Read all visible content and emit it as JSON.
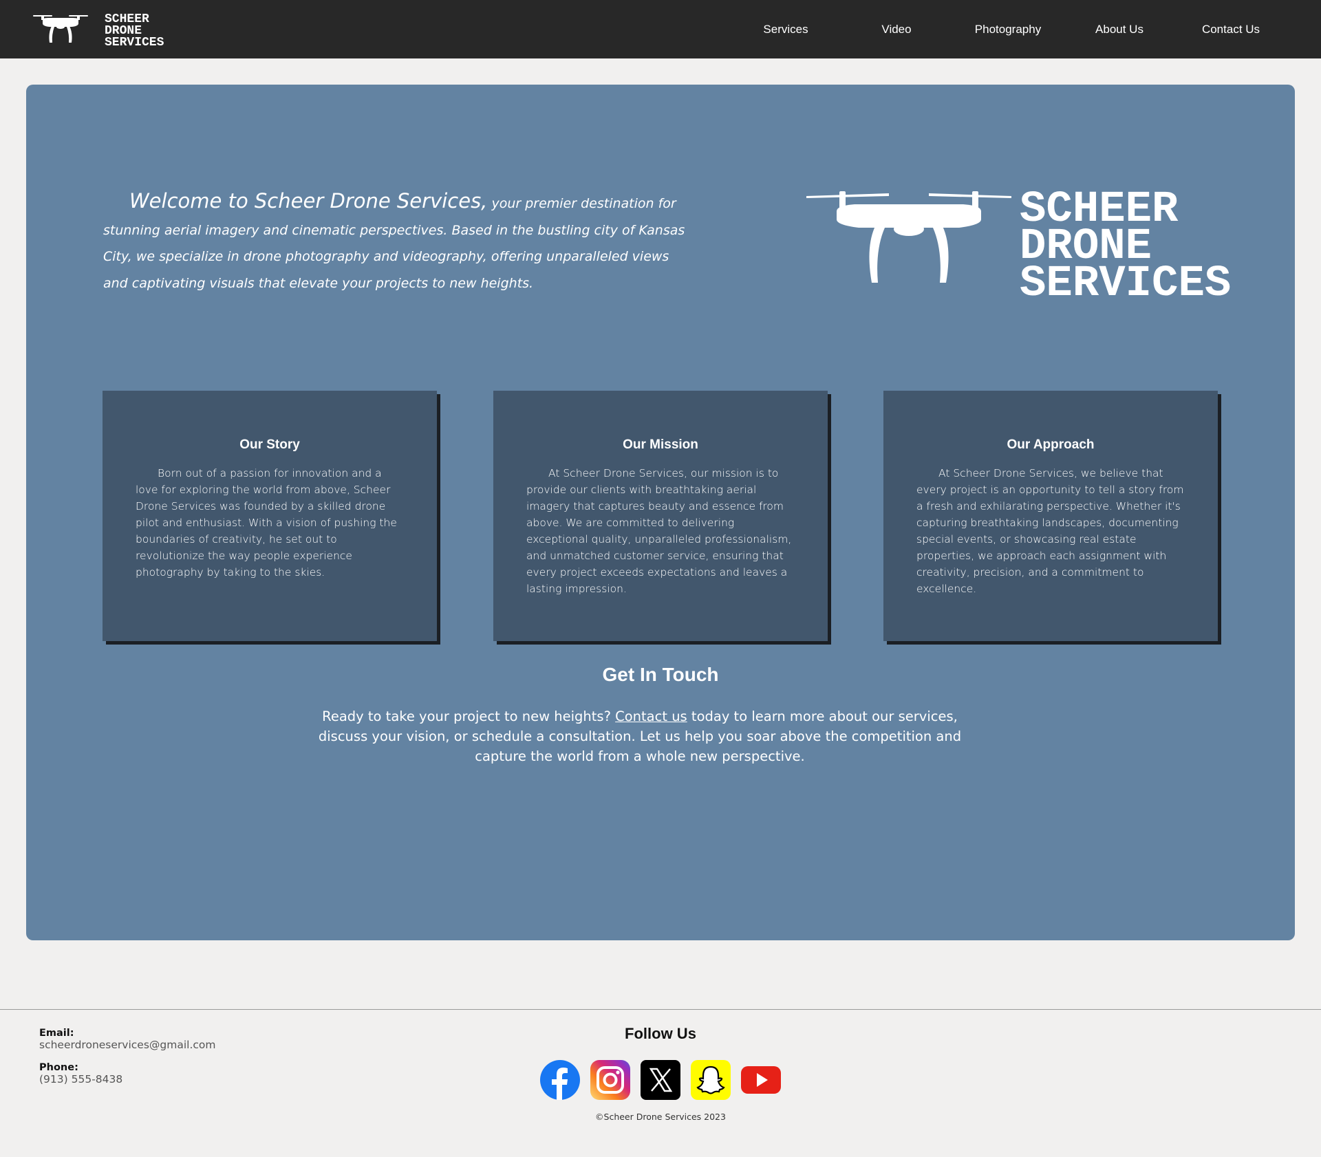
{
  "header": {
    "logo_text": [
      "SCHEER",
      "DRONE",
      "SERVICES"
    ],
    "nav": [
      {
        "label": "Services"
      },
      {
        "label": "Video"
      },
      {
        "label": "Photography"
      },
      {
        "label": "About Us"
      },
      {
        "label": "Contact Us"
      }
    ]
  },
  "hero": {
    "welcome_lead": "Welcome to Scheer Drone Services,",
    "welcome_rest": " your premier destination for stunning aerial imagery and cinematic perspectives. Based in the bustling city of Kansas City, we specialize in drone photography and videography, offering unparalleled views and captivating visuals that elevate your projects to new heights.",
    "logo_text": [
      "SCHEER",
      "DRONE",
      "SERVICES"
    ]
  },
  "cards": [
    {
      "title": "Our Story",
      "body": "Born out of a passion for innovation and a love for exploring the world from above, Scheer Drone Services was founded by a skilled drone pilot and enthusiast. With a vision of pushing the boundaries of creativity, he set out to revolutionize the way people experience photography by taking to the skies."
    },
    {
      "title": "Our Mission",
      "body": "At Scheer Drone Services, our mission is to provide our clients with breathtaking aerial imagery that captures beauty and essence from above. We are committed to delivering exceptional quality, unparalleled professionalism, and unmatched customer service, ensuring that every project exceeds expectations and leaves a lasting impression."
    },
    {
      "title": "Our Approach",
      "body": "At Scheer Drone Services, we believe that every project is an opportunity to tell a story from a fresh and exhilarating perspective. Whether it's capturing breathtaking landscapes, documenting special events, or showcasing real estate properties, we approach each assignment with creativity, precision, and a commitment to excellence."
    }
  ],
  "touch": {
    "title": "Get In Touch",
    "text_before": "Ready to take your project to new heights? ",
    "link": "Contact us",
    "text_after": " today to learn more about our services, discuss your vision, or schedule a consultation. Let us help you soar above the competition and capture the world from a whole new perspective."
  },
  "footer": {
    "email_label": "Email:",
    "email": "scheerdroneservices@gmail.com",
    "phone_label": "Phone:",
    "phone": "(913) 555-8438",
    "follow_title": "Follow Us",
    "socials": [
      {
        "icon": "facebook-icon",
        "color": "#1877f2"
      },
      {
        "icon": "instagram-icon",
        "color": "#d62976"
      },
      {
        "icon": "x-icon",
        "color": "#000000"
      },
      {
        "icon": "snapchat-icon",
        "color": "#fffc00"
      },
      {
        "icon": "youtube-icon",
        "color": "#e62117"
      }
    ],
    "copyright": "©Scheer Drone Services 2023"
  },
  "colors": {
    "header_bg": "#282828",
    "panel_bg": "#6383a2",
    "card_bg": "#42576d",
    "page_bg": "#f1f0ef"
  }
}
